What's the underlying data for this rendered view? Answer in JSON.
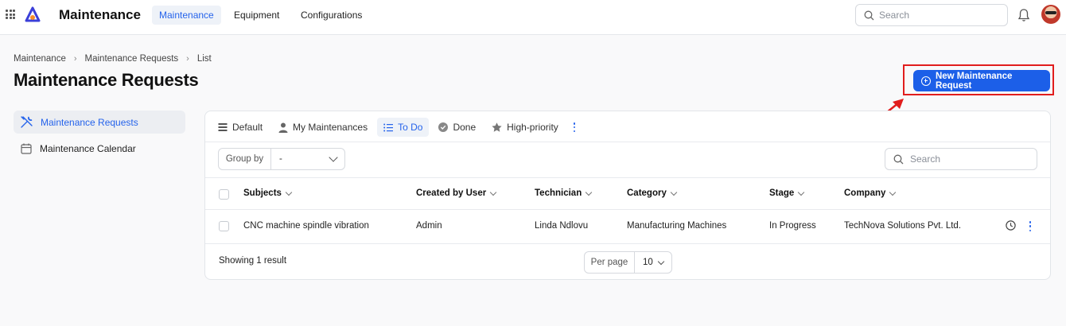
{
  "app": {
    "name": "Maintenance"
  },
  "topnav": {
    "items": [
      {
        "label": "Maintenance",
        "active": true
      },
      {
        "label": "Equipment",
        "active": false
      },
      {
        "label": "Configurations",
        "active": false
      }
    ],
    "search_placeholder": "Search"
  },
  "breadcrumb": [
    "Maintenance",
    "Maintenance Requests",
    "List"
  ],
  "page_title": "Maintenance Requests",
  "new_button_label": "New Maintenance Request",
  "sidebar": {
    "items": [
      {
        "label": "Maintenance Requests",
        "icon": "tools-icon",
        "active": true
      },
      {
        "label": "Maintenance Calendar",
        "icon": "calendar-icon",
        "active": false
      }
    ]
  },
  "views": [
    {
      "label": "Default",
      "icon": "list-rows-icon",
      "active": false
    },
    {
      "label": "My Maintenances",
      "icon": "user-icon",
      "active": false
    },
    {
      "label": "To Do",
      "icon": "checklist-icon",
      "active": true
    },
    {
      "label": "Done",
      "icon": "check-circle-icon",
      "active": false
    },
    {
      "label": "High-priority",
      "icon": "star-icon",
      "active": false
    }
  ],
  "group_by": {
    "label": "Group by",
    "value": "-"
  },
  "panel_search_placeholder": "Search",
  "table": {
    "columns": [
      "Subjects",
      "Created by User",
      "Technician",
      "Category",
      "Stage",
      "Company"
    ],
    "rows": [
      [
        "CNC machine spindle vibration",
        "Admin",
        "Linda Ndlovu",
        "Manufacturing Machines",
        "In Progress",
        "TechNova Solutions Pvt. Ltd."
      ]
    ]
  },
  "footer": {
    "result_text": "Showing 1 result",
    "per_page_label": "Per page",
    "per_page_value": "10"
  },
  "colors": {
    "accent": "#1c5fe8",
    "highlight_frame": "#e11d1d"
  }
}
